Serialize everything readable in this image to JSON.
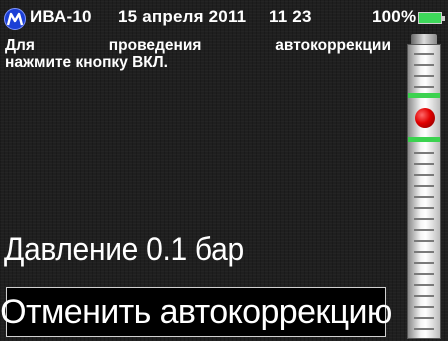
{
  "status": {
    "device": "ИВА-10",
    "date": "15 апреля 2011",
    "time": "11 23",
    "battery": "100%"
  },
  "message": {
    "words_line1": [
      "Для",
      "проведения",
      "автокоррекции"
    ],
    "line2": "нажмите кнопку ВКЛ."
  },
  "pressure": "Давление 0.1 бар",
  "cancel_label": "Отменить автокоррекцию",
  "colors": {
    "accent_green": "#3bd24f",
    "indicator_red": "#e10000",
    "logo_blue": "#1b3fd6"
  },
  "icons": [
    "logo-icon",
    "battery-icon",
    "level-ball"
  ]
}
